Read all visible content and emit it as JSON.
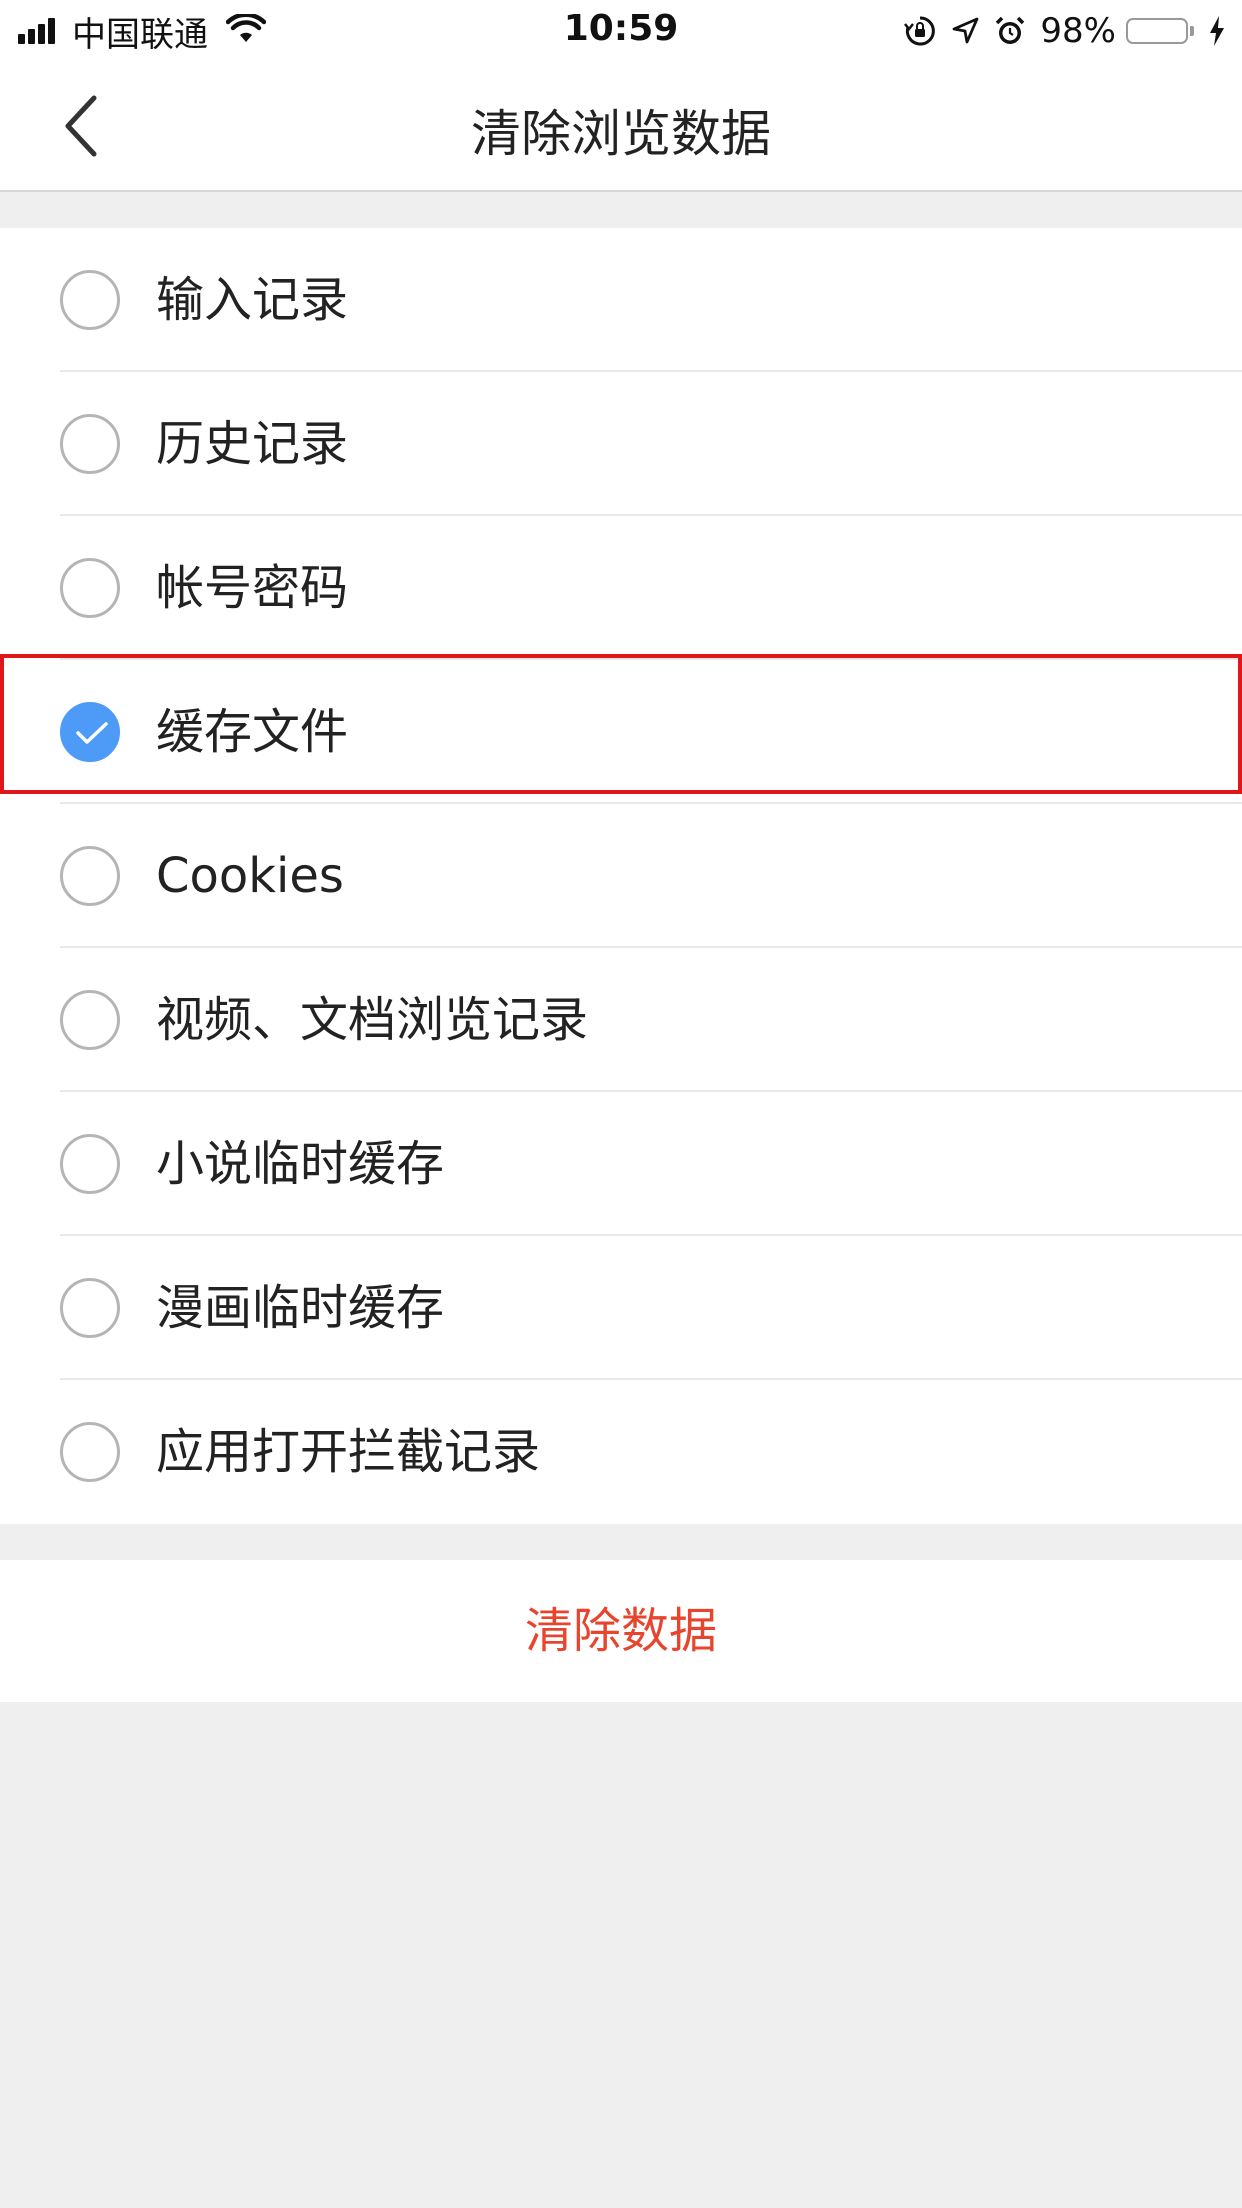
{
  "status_bar": {
    "carrier": "中国联通",
    "time": "10:59",
    "battery_percent": "98%",
    "battery_level": 0.98,
    "battery_color": "#4cd964",
    "icons": [
      "signal-icon",
      "wifi-icon",
      "rotation-lock-icon",
      "location-icon",
      "alarm-icon",
      "battery-icon",
      "charging-icon"
    ]
  },
  "nav": {
    "title": "清除浏览数据",
    "back_icon": "chevron-left-icon"
  },
  "options": [
    {
      "label": "输入记录",
      "checked": false
    },
    {
      "label": "历史记录",
      "checked": false
    },
    {
      "label": "帐号密码",
      "checked": false
    },
    {
      "label": "缓存文件",
      "checked": true,
      "highlighted": true
    },
    {
      "label": "Cookies",
      "checked": false
    },
    {
      "label": "视频、文档浏览记录",
      "checked": false
    },
    {
      "label": "小说临时缓存",
      "checked": false
    },
    {
      "label": "漫画临时缓存",
      "checked": false
    },
    {
      "label": "应用打开拦截记录",
      "checked": false
    }
  ],
  "clear_button": {
    "label": "清除数据",
    "color": "#e8452e"
  },
  "colors": {
    "accent_blue": "#4d9bf7",
    "highlight_border": "#e0161a",
    "background": "#efefef"
  }
}
